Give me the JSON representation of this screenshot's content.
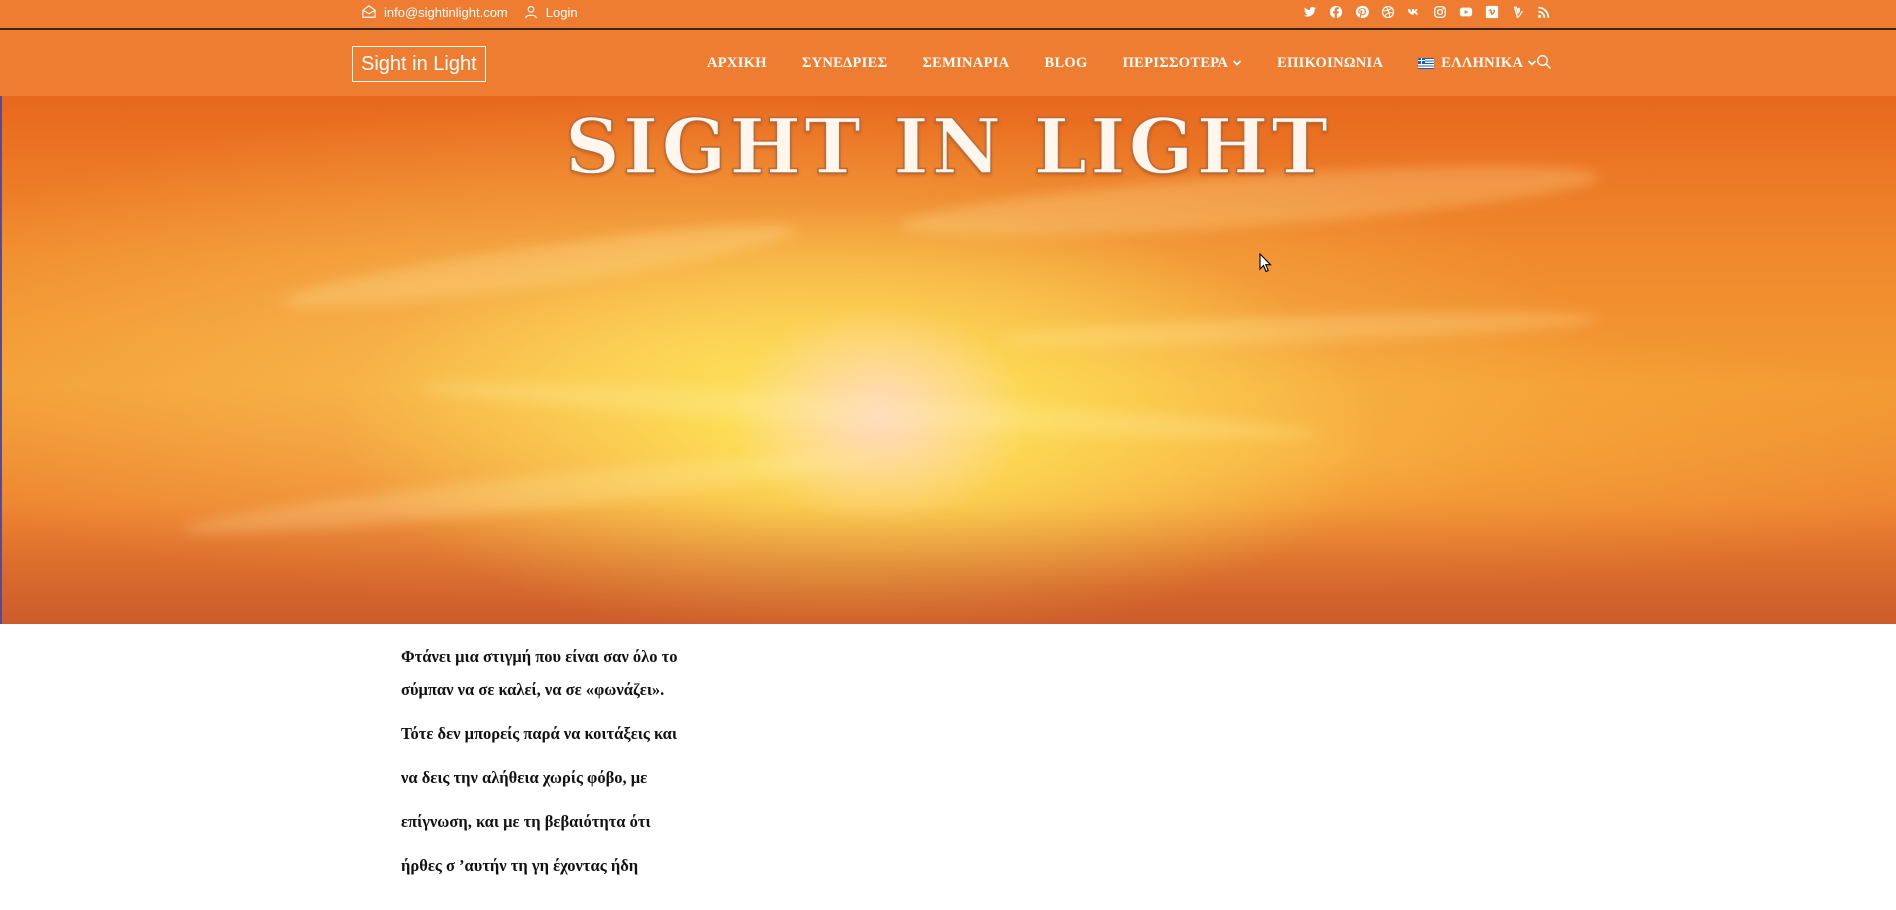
{
  "topbar": {
    "email": "info@sightinlight.com",
    "login": "Login",
    "social_icons": [
      "twitter-icon",
      "facebook-icon",
      "pinterest-icon",
      "dribbble-icon",
      "vk-icon",
      "instagram-icon",
      "youtube-icon",
      "vimeo-icon",
      "vine-icon",
      "rss-icon"
    ]
  },
  "header": {
    "logo": "Sight in Light",
    "menu": [
      {
        "label": "ΑΡΧΙΚΗ",
        "dropdown": false
      },
      {
        "label": "ΣΥΝΕΔΡΙΕΣ",
        "dropdown": false
      },
      {
        "label": "ΣΕΜΙΝΑΡΙΑ",
        "dropdown": false
      },
      {
        "label": "BLOG",
        "dropdown": false
      },
      {
        "label": "ΠΕΡΙΣΣΟΤΕΡΑ",
        "dropdown": true
      },
      {
        "label": "ΕΠΙΚΟΙΝΩΝΙΑ",
        "dropdown": false
      },
      {
        "label": "ΕΛΛΗΝΙΚΑ",
        "dropdown": true,
        "flag": "greek-flag-icon"
      }
    ]
  },
  "hero": {
    "title": "SIGHT IN LIGHT"
  },
  "content": {
    "lines": [
      "Φτάνει μια στιγμή που είναι σαν όλο το",
      "σύμπαν  να σε καλεί, να σε «φωνάζει».",
      "Τότε δεν μπορείς παρά να κοιτάξεις και",
      "να δεις την αλήθεια χωρίς φόβο, με",
      "επίγνωση, και με τη βεβαιότητα ότι",
      "ήρθες σ ’αυτήν τη γη έχοντας ήδη"
    ]
  },
  "colors": {
    "brand_orange": "#ee7d32",
    "text_dark": "#111111"
  }
}
